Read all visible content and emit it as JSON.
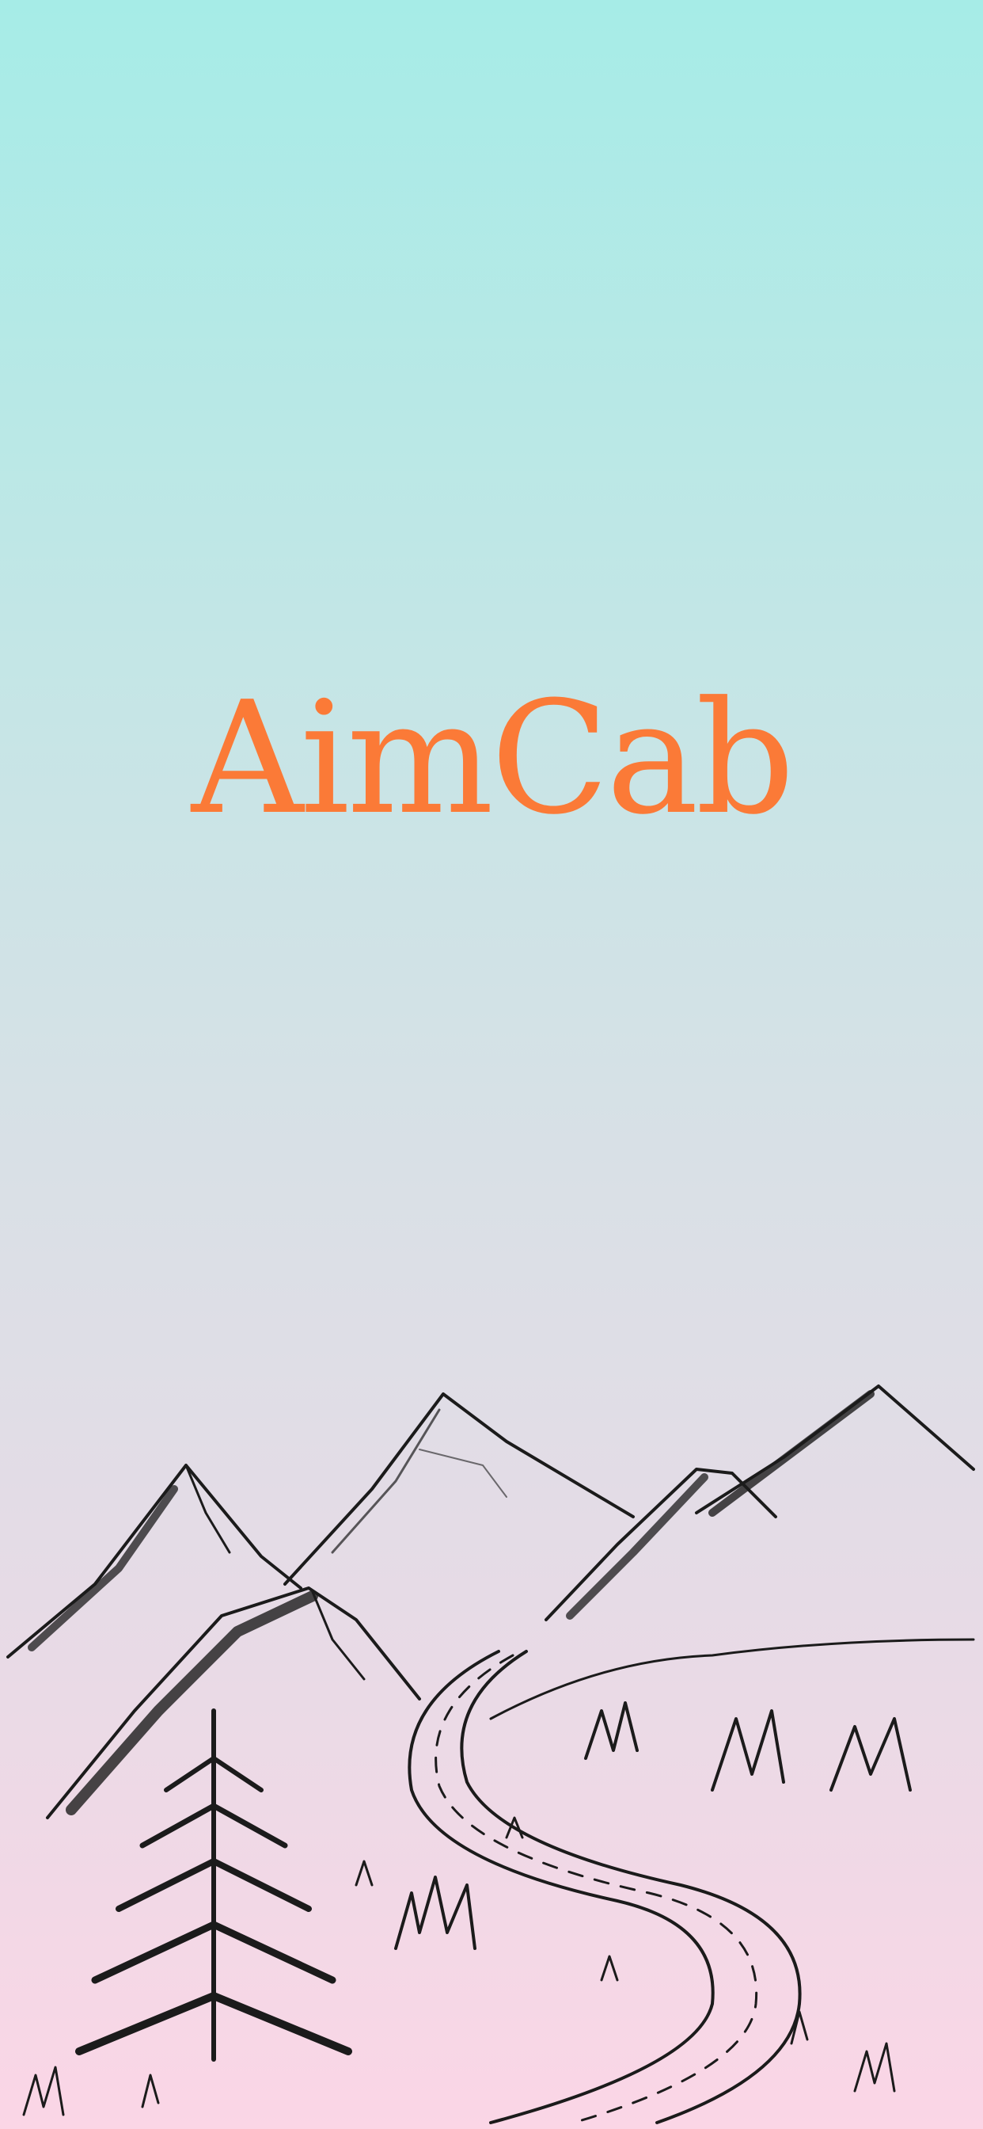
{
  "app": {
    "name": "AimCab",
    "brand_color": "#fb7a37",
    "gradient_top": "#a6ece7",
    "gradient_bottom": "#fbd6e6"
  },
  "illustration": {
    "icon": "mountain-road-sketch-icon"
  }
}
